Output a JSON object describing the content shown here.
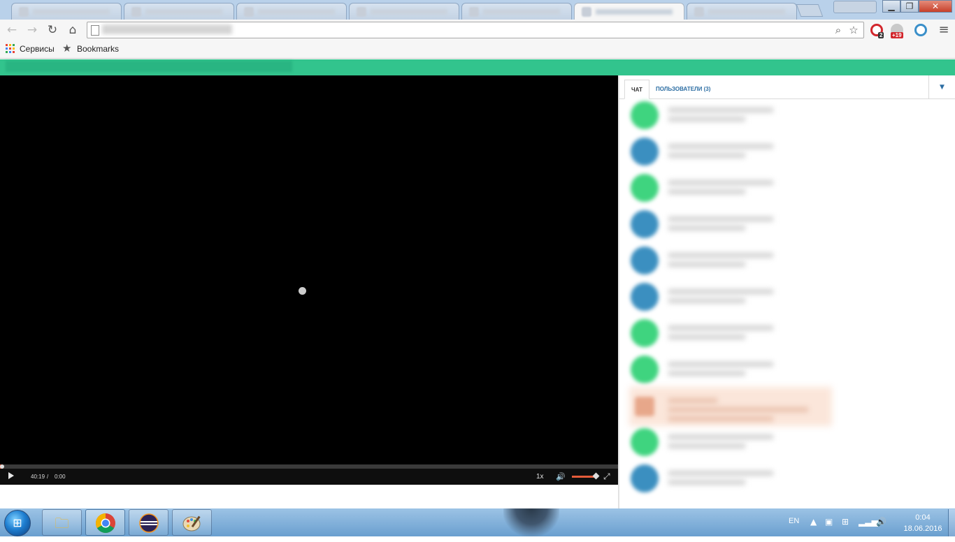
{
  "browser": {
    "tab_count": 7,
    "active_tab_index": 5,
    "bookmarks": {
      "apps_label": "Сервисы",
      "bookmarks_label": "Bookmarks"
    },
    "extensions": {
      "opera_badge": "2",
      "globe_badge": "+19"
    },
    "window_buttons": {
      "minimize": "▁",
      "maximize": "❐",
      "close": "✕"
    },
    "nav_icons": {
      "back": "←",
      "forward": "→",
      "reload": "↻",
      "home": "⌂"
    },
    "omnibox_icons": {
      "zoom": "⌕",
      "star": "☆"
    },
    "menu_icon": "≡"
  },
  "player": {
    "duration": "40:19",
    "separator": "/",
    "current_time": "0:00",
    "speed": "1x",
    "progress": 0.0,
    "volume": 1.0,
    "icons": {
      "play": "play-icon",
      "volume": "🔊",
      "fullscreen": "⤢"
    }
  },
  "chat": {
    "tab_chat": "ЧАТ",
    "tab_users": "ПОЛЬЗОВАТЕЛИ (3)",
    "dropdown_icon": "▼",
    "messages": [
      {
        "color": "#3fd47f",
        "highlight": false
      },
      {
        "color": "#3b8fc0",
        "highlight": false
      },
      {
        "color": "#3fd47f",
        "highlight": false
      },
      {
        "color": "#3b8fc0",
        "highlight": false
      },
      {
        "color": "#3b8fc0",
        "highlight": false
      },
      {
        "color": "#3b8fc0",
        "highlight": false
      },
      {
        "color": "#3fd47f",
        "highlight": false
      },
      {
        "color": "#3fd47f",
        "highlight": false
      },
      {
        "color": "#e7a78a",
        "highlight": true
      },
      {
        "color": "#3fd47f",
        "highlight": false
      },
      {
        "color": "#3b8fc0",
        "highlight": false
      }
    ]
  },
  "taskbar": {
    "apps": [
      "file-explorer",
      "chrome",
      "eclipse",
      "paint"
    ],
    "active_app": "chrome",
    "language": "EN",
    "time": "0:04",
    "date": "18.06.2016"
  },
  "colors": {
    "site_green": "#32c48d",
    "accent_orange": "#e45c3a",
    "link_blue": "#2d6ea3"
  }
}
